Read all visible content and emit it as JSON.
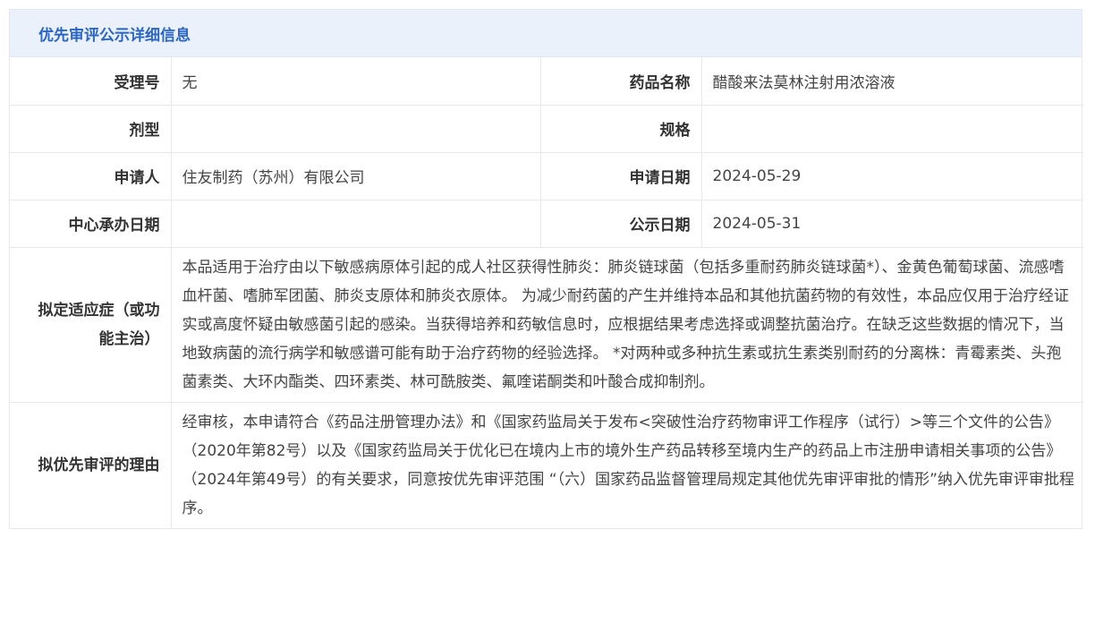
{
  "header": {
    "title": "优先审评公示详细信息"
  },
  "rows": {
    "acceptance_no": {
      "label": "受理号",
      "value": "无"
    },
    "drug_name": {
      "label": "药品名称",
      "value": "醋酸来法莫林注射用浓溶液"
    },
    "dosage_form": {
      "label": "剂型",
      "value": ""
    },
    "specification": {
      "label": "规格",
      "value": ""
    },
    "applicant": {
      "label": "申请人",
      "value": "住友制药（苏州）有限公司"
    },
    "application_date": {
      "label": "申请日期",
      "value": "2024-05-29"
    },
    "center_date": {
      "label": "中心承办日期",
      "value": ""
    },
    "publication_date": {
      "label": "公示日期",
      "value": "2024-05-31"
    },
    "indication": {
      "label": "拟定适应症（或功能主治）",
      "value": "本品适用于治疗由以下敏感病原体引起的成人社区获得性肺炎：肺炎链球菌（包括多重耐药肺炎链球菌*）、金黄色葡萄球菌、流感嗜血杆菌、嗜肺军团菌、肺炎支原体和肺炎衣原体。 为减少耐药菌的产生并维持本品和其他抗菌药物的有效性，本品应仅用于治疗经证实或高度怀疑由敏感菌引起的感染。当获得培养和药敏信息时，应根据结果考虑选择或调整抗菌治疗。在缺乏这些数据的情况下，当地致病菌的流行病学和敏感谱可能有助于治疗药物的经验选择。 *对两种或多种抗生素或抗生素类别耐药的分离株：青霉素类、头孢菌素类、大环内酯类、四环素类、林可酰胺类、氟喹诺酮类和叶酸合成抑制剂。"
    },
    "reason": {
      "label": "拟优先审评的理由",
      "value": "经审核，本申请符合《药品注册管理办法》和《国家药监局关于发布<突破性治疗药物审评工作程序（试行）>等三个文件的公告》（2020年第82号）以及《国家药监局关于优化已在境内上市的境外生产药品转移至境内生产的药品上市注册申请相关事项的公告》（2024年第49号）的有关要求，同意按优先审评范围 “（六）国家药品监督管理局规定其他优先审评审批的情形”纳入优先审评审批程序。"
    }
  }
}
